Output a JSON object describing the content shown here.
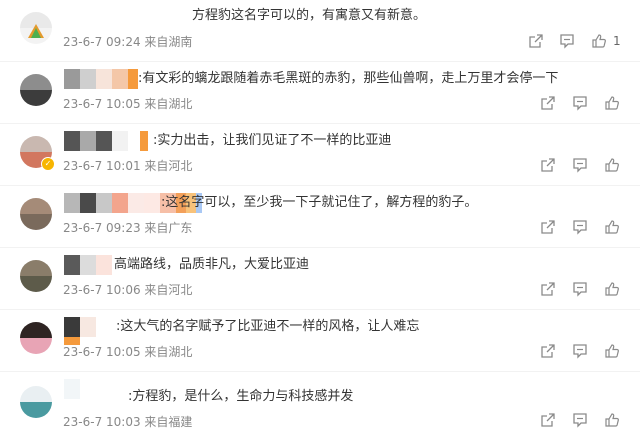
{
  "comments": [
    {
      "text": "方程豹这名字可以的，有寓意又有新意。",
      "meta": "23-6-7 09:24 来自湖南",
      "likes": "1"
    },
    {
      "text": ":有文彩的螭龙跟随着赤毛黑斑的赤豹，那些仙兽啊，走上万里才会停一下",
      "meta": "23-6-7 10:05 来自湖北",
      "likes": ""
    },
    {
      "text": ":实力出击，让我们见证了不一样的比亚迪",
      "meta": "23-6-7 10:01 来自河北",
      "likes": ""
    },
    {
      "text": ":这名字可以，至少我一下子就记住了，解方程的豹子。",
      "meta": "23-6-7 09:23 来自广东",
      "likes": ""
    },
    {
      "text": "高端路线，品质非凡，大爱比亚迪",
      "meta": "23-6-7 10:06 来自河北",
      "likes": ""
    },
    {
      "text": ":这大气的名字赋予了比亚迪不一样的风格，让人难忘",
      "meta": "23-6-7 10:05 来自湖北",
      "likes": ""
    },
    {
      "text": ":方程豹，是什么，生命力与科技感并发",
      "meta": "23-6-7 10:03 来自福建",
      "likes": ""
    }
  ],
  "icons": {
    "share": "share-icon",
    "comment": "comment-icon",
    "like": "thumbs-up-icon"
  },
  "colors": {
    "text": "#333333",
    "meta": "#888888",
    "icon": "#8a8a8a"
  }
}
